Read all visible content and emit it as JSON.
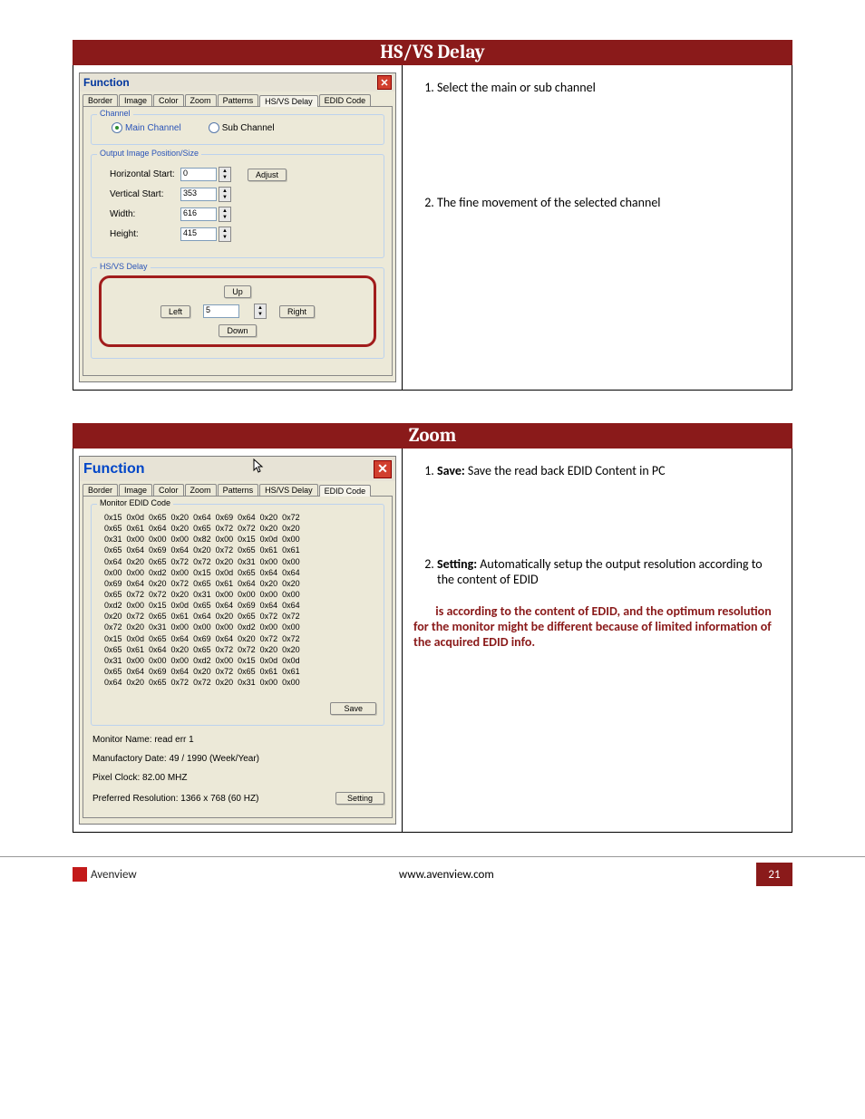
{
  "sections": {
    "hsvs": {
      "title": "HS/VS Delay",
      "window_title": "Function",
      "tabs": [
        "Border",
        "Image",
        "Color",
        "Zoom",
        "Patterns",
        "HS/VS Delay",
        "EDID Code"
      ],
      "active_tab": 5,
      "channel": {
        "frame": "Channel",
        "main": "Main Channel",
        "sub": "Sub Channel"
      },
      "output": {
        "frame": "Output Image Position/Size",
        "rows": [
          {
            "lbl": "Horizontal Start:",
            "val": "0",
            "btn": "Adjust"
          },
          {
            "lbl": "Vertical Start:",
            "val": "353"
          },
          {
            "lbl": "Width:",
            "val": "616"
          },
          {
            "lbl": "Height:",
            "val": "415"
          }
        ]
      },
      "delay": {
        "frame": "HS/VS Delay",
        "up": "Up",
        "down": "Down",
        "left": "Left",
        "right": "Right",
        "val": "5"
      },
      "steps": [
        "Select the main or sub channel",
        "The fine movement of the selected channel"
      ]
    },
    "zoom": {
      "title": "Zoom",
      "window_title": "Function",
      "tabs": [
        "Border",
        "Image",
        "Color",
        "Zoom",
        "Patterns",
        "HS/VS Delay",
        "EDID Code"
      ],
      "active_tab": 6,
      "edid_frame": "Monitor EDID Code",
      "edid_rows": [
        "0x15  0x0d  0x65  0x20  0x64  0x69  0x64  0x20  0x72",
        "0x65  0x61  0x64  0x20  0x65  0x72  0x72  0x20  0x20",
        "0x31  0x00  0x00  0x00  0x82  0x00  0x15  0x0d  0x00",
        "0x65  0x64  0x69  0x64  0x20  0x72  0x65  0x61  0x61",
        "0x64  0x20  0x65  0x72  0x72  0x20  0x31  0x00  0x00",
        "0x00  0x00  0xd2  0x00  0x15  0x0d  0x65  0x64  0x64",
        "0x69  0x64  0x20  0x72  0x65  0x61  0x64  0x20  0x20",
        "0x65  0x72  0x72  0x20  0x31  0x00  0x00  0x00  0x00",
        "0xd2  0x00  0x15  0x0d  0x65  0x64  0x69  0x64  0x64",
        "0x20  0x72  0x65  0x61  0x64  0x20  0x65  0x72  0x72",
        "0x72  0x20  0x31  0x00  0x00  0x00  0xd2  0x00  0x00",
        "0x15  0x0d  0x65  0x64  0x69  0x64  0x20  0x72  0x72",
        "0x65  0x61  0x64  0x20  0x65  0x72  0x72  0x20  0x20",
        "0x31  0x00  0x00  0x00  0xd2  0x00  0x15  0x0d  0x0d",
        "0x65  0x64  0x69  0x64  0x20  0x72  0x65  0x61  0x61",
        "0x64  0x20  0x65  0x72  0x72  0x20  0x31  0x00  0x00"
      ],
      "save_btn": "Save",
      "info": {
        "monitor": "Monitor Name: read err 1",
        "mfg": "Manufactory Date: 49 / 1990 (Week/Year)",
        "clock": "Pixel Clock: 82.00 MHZ",
        "res": "Preferred Resolution: 1366 x 768 (60 HZ)"
      },
      "setting_btn": "Setting",
      "steps": [
        {
          "b": "Save:",
          "t": " Save the read back EDID Content in PC"
        },
        {
          "b": "Setting:",
          "t": " Automatically setup the output resolution according to the content of EDID"
        }
      ],
      "note": "is according to the content of EDID, and the optimum resolution for the monitor might be different because of limited information of the acquired EDID info."
    }
  },
  "footer": {
    "url": "www.avenview.com",
    "brand": "Avenview",
    "page": "21"
  }
}
